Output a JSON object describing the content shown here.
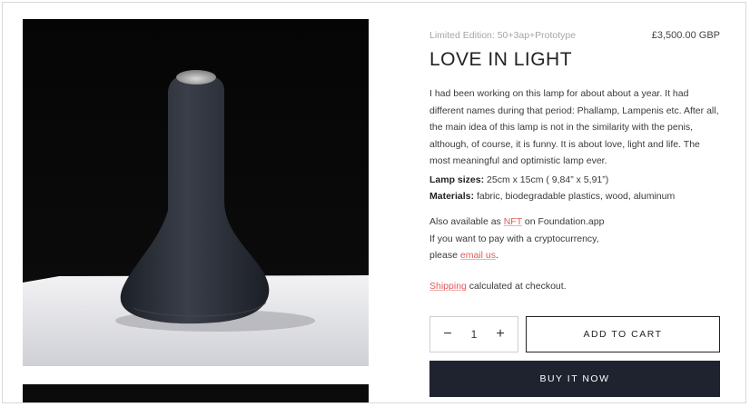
{
  "product": {
    "edition": "Limited Edition: 50+3ap+Prototype",
    "price": "£3,500.00 GBP",
    "title": "LOVE IN LIGHT",
    "description": "I had been working on this lamp for about about a year. It had different names during that period: Phallamp, Lampenis etc. After all, the main idea of this lamp is not in the similarity with the penis, although, of course, it is funny. It is about love, light and life. The most meaningful and optimistic lamp ever.",
    "sizes_label": "Lamp sizes:",
    "sizes_value": " 25cm x 15cm ( 9,84” x 5,91”)",
    "materials_label": "Materials:",
    "materials_value": " fabric, biodegradable plastics, wood, aluminum",
    "nft_prefix": "Also available as ",
    "nft_link": "NFT",
    "nft_suffix": " on Foundation.app",
    "crypto_line": "If you want to pay with a cryptocurrency,",
    "email_prefix": "please ",
    "email_link": "email us",
    "email_suffix": ".",
    "shipping_link": "Shipping",
    "shipping_suffix": " calculated at checkout."
  },
  "cart": {
    "minus": "−",
    "quantity": "1",
    "plus": "+",
    "add_to_cart": "ADD TO CART",
    "buy_now": "BUY IT NOW"
  },
  "colors": {
    "accent_link": "#e35a5a",
    "buy_button_bg": "#1f2330"
  }
}
